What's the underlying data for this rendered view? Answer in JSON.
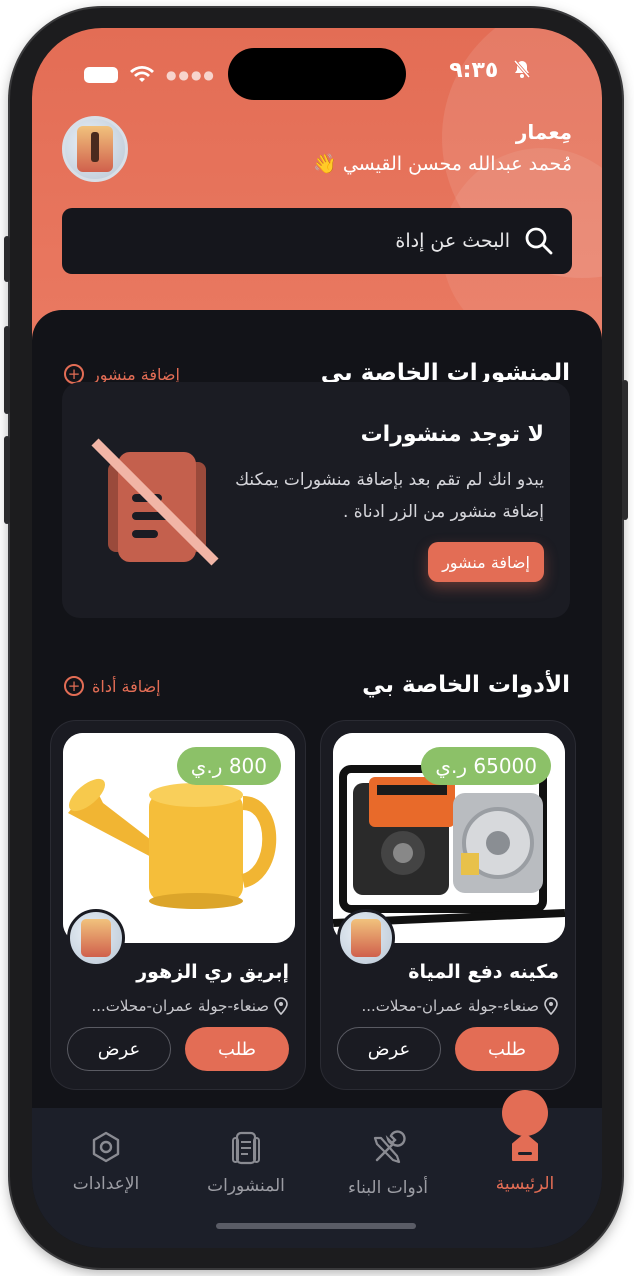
{
  "status_bar": {
    "time": "٩:٣٥"
  },
  "header": {
    "role": "مِعمار",
    "user_name": "مُحمد عبدالله محسن القيسي 👋"
  },
  "search": {
    "placeholder": "البحث عن إداة"
  },
  "posts_section": {
    "title": "المنشورات الخاصة بي",
    "add_label": "إضافة منشور",
    "empty_title": "لا توجد منشورات",
    "empty_desc": "يبدو انك لم تقم بعد بإضافة منشورات يمكنك إضافة منشور من الزر ادناة .",
    "empty_button": "إضافة منشور"
  },
  "tools_section": {
    "title": "الأدوات الخاصة بي",
    "add_label": "إضافة أداة",
    "tools": [
      {
        "name": "مكينه دفع المياة",
        "price": "65000 ر.ي",
        "location": "صنعاء-جولة عمران-محلات...",
        "order_label": "طلب",
        "view_label": "عرض"
      },
      {
        "name": "إبريق ري الزهور",
        "price": "800 ر.ي",
        "location": "صنعاء-جولة عمران-محلات...",
        "order_label": "طلب",
        "view_label": "عرض"
      }
    ]
  },
  "bottom_nav": {
    "items": [
      {
        "label": "الرئيسية",
        "icon": "home-icon",
        "active": true
      },
      {
        "label": "أدوات البناء",
        "icon": "tools-icon",
        "active": false
      },
      {
        "label": "المنشورات",
        "icon": "posts-icon",
        "active": false
      },
      {
        "label": "الإعدادات",
        "icon": "settings-icon",
        "active": false
      }
    ]
  },
  "colors": {
    "accent": "#e36d55",
    "background": "#121318",
    "card": "#1b1c23",
    "price_badge": "#8cc168"
  }
}
